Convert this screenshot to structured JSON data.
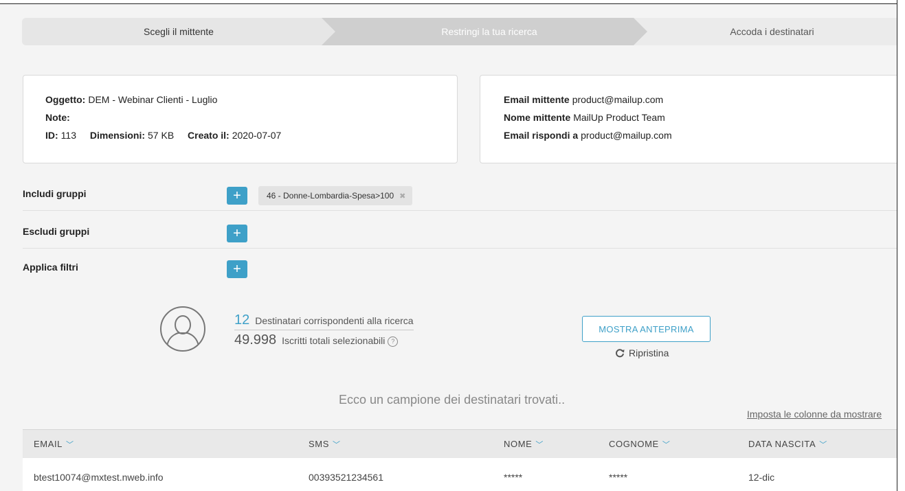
{
  "wizard": {
    "steps": [
      {
        "label": "Scegli il mittente"
      },
      {
        "label": "Restringi la tua ricerca"
      },
      {
        "label": "Accoda i destinatari"
      }
    ]
  },
  "message_info": {
    "subject_label": "Oggetto:",
    "subject": "DEM - Webinar Clienti - Luglio",
    "notes_label": "Note:",
    "notes": "",
    "id_label": "ID:",
    "id": "113",
    "size_label": "Dimensioni:",
    "size": "57 KB",
    "created_label": "Creato il:",
    "created": "2020-07-07"
  },
  "sender_info": {
    "email_label": "Email mittente",
    "email": "product@mailup.com",
    "name_label": "Nome mittente",
    "name": "MailUp Product Team",
    "reply_label": "Email rispondi a",
    "reply": "product@mailup.com"
  },
  "groups": {
    "include_label": "Includi gruppi",
    "include_tags": [
      "46 - Donne-Lombardia-Spesa>100"
    ],
    "exclude_label": "Escludi gruppi",
    "filters_label": "Applica filtri",
    "add_symbol": "+",
    "remove_symbol": "✖"
  },
  "summary": {
    "matching_count": "12",
    "matching_text": "Destinatari corrispondenti alla ricerca",
    "total_count": "49.998",
    "total_text": "Iscritti totali selezionabili",
    "help_symbol": "?"
  },
  "actions": {
    "preview_label": "MOSTRA ANTEPRIMA",
    "reset_label": "Ripristina"
  },
  "sample": {
    "title": "Ecco un campione dei destinatari trovati..",
    "columns_link": "Imposta le colonne da mostrare"
  },
  "table": {
    "columns": [
      "EMAIL",
      "SMS",
      "NOME",
      "COGNOME",
      "DATA NASCITA"
    ],
    "rows": [
      [
        "btest10074@mxtest.nweb.info",
        "00393521234561",
        "*****",
        "*****",
        "12-dic"
      ]
    ]
  },
  "colors": {
    "accent": "#3ea0c8",
    "background": "#f4f4f4"
  }
}
